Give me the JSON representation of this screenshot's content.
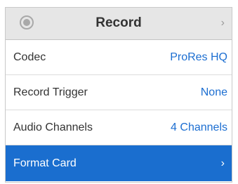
{
  "header": {
    "title": "Record",
    "icon": "record-icon",
    "chevron": "›"
  },
  "rows": [
    {
      "label": "Codec",
      "value": "ProRes HQ"
    },
    {
      "label": "Record Trigger",
      "value": "None"
    },
    {
      "label": "Audio Channels",
      "value": "4 Channels"
    },
    {
      "label": "Format Card",
      "value": "›",
      "selected": true
    }
  ],
  "colors": {
    "accent": "#1a6ecf",
    "value_text": "#1c6ed1",
    "header_bg": "#e6e6e6"
  }
}
